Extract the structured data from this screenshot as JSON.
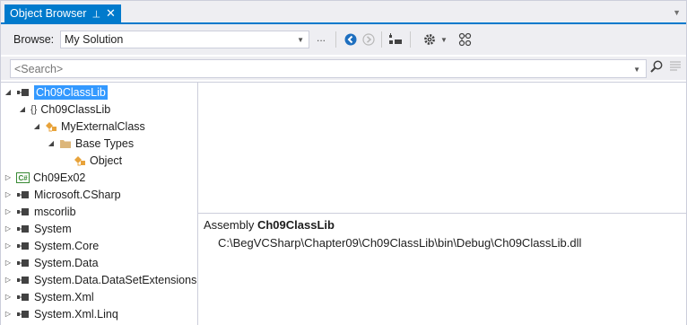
{
  "window": {
    "tab_title": "Object Browser",
    "pin_glyph": "⊣",
    "close_glyph": "✕"
  },
  "toolbar": {
    "browse_label": "Browse:",
    "browse_value": "My Solution",
    "ellipsis": "..."
  },
  "search": {
    "placeholder": "<Search>",
    "value": ""
  },
  "tree": {
    "items": [
      {
        "label": "Ch09ClassLib",
        "icon": "assembly-icon",
        "expanded": true,
        "selected": true
      },
      {
        "label": "Ch09ClassLib",
        "icon": "namespace-icon",
        "expanded": true
      },
      {
        "label": "MyExternalClass",
        "icon": "class-icon",
        "expanded": true
      },
      {
        "label": "Base Types",
        "icon": "folder-icon",
        "expanded": true
      },
      {
        "label": "Object",
        "icon": "class-icon"
      },
      {
        "label": "Ch09Ex02",
        "icon": "csharp-project-icon",
        "expanded": false
      },
      {
        "label": "Microsoft.CSharp",
        "icon": "assembly-icon",
        "expanded": false
      },
      {
        "label": "mscorlib",
        "icon": "assembly-icon",
        "expanded": false
      },
      {
        "label": "System",
        "icon": "assembly-icon",
        "expanded": false
      },
      {
        "label": "System.Core",
        "icon": "assembly-icon",
        "expanded": false
      },
      {
        "label": "System.Data",
        "icon": "assembly-icon",
        "expanded": false
      },
      {
        "label": "System.Data.DataSetExtensions",
        "icon": "assembly-icon",
        "expanded": false
      },
      {
        "label": "System.Xml",
        "icon": "assembly-icon",
        "expanded": false
      },
      {
        "label": "System.Xml.Linq",
        "icon": "assembly-icon",
        "expanded": false
      }
    ]
  },
  "description": {
    "prefix": "Assembly ",
    "name": "Ch09ClassLib",
    "path": "C:\\BegVCSharp\\Chapter09\\Ch09ClassLib\\bin\\Debug\\Ch09ClassLib.dll"
  },
  "colors": {
    "accent": "#007acc",
    "selection": "#3399ff",
    "class_icon": "#e8a33b",
    "folder_icon": "#dcb67a"
  }
}
